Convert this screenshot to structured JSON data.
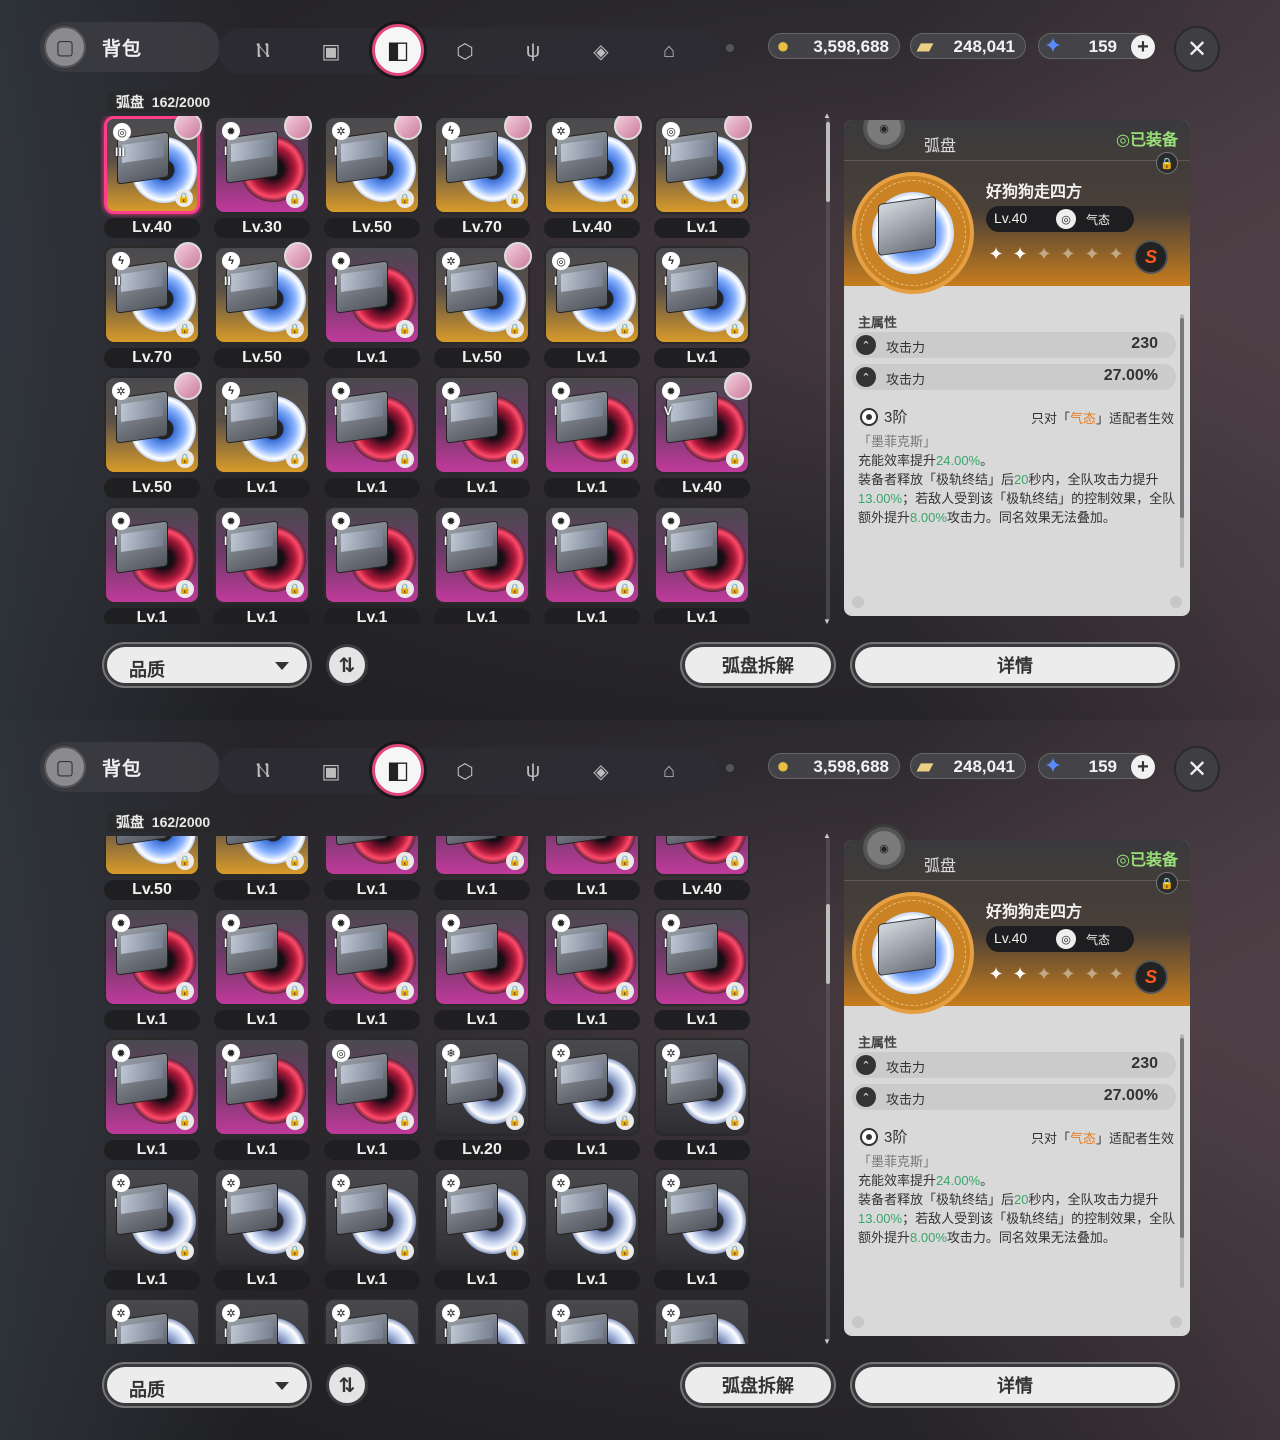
{
  "header": {
    "title": "背包",
    "tabs": [
      {
        "icon": "n-logo-icon"
      },
      {
        "icon": "gameboy-icon"
      },
      {
        "icon": "disc-tab-icon",
        "active": true
      },
      {
        "icon": "cube-icon"
      },
      {
        "icon": "fork-knife-icon"
      },
      {
        "icon": "box-stack-icon"
      },
      {
        "icon": "home-icon"
      }
    ],
    "currencies": [
      {
        "icon": "gold-coin-icon",
        "value": "3,598,688"
      },
      {
        "icon": "ticket-icon",
        "value": "248,041"
      },
      {
        "icon": "crystal-icon",
        "value": "159"
      }
    ],
    "close_label": "✕"
  },
  "grid": {
    "category": "弧盘",
    "count": "162/2000"
  },
  "screen1_rows": [
    [
      {
        "lv": "Lv.40",
        "q": "gold",
        "rank": "III",
        "avatar": true,
        "selected": true,
        "attr": "ether"
      },
      {
        "lv": "Lv.30",
        "q": "purple",
        "rank": "I",
        "avatar": true,
        "attr": "fire"
      },
      {
        "lv": "Lv.50",
        "q": "gold",
        "rank": "I",
        "avatar": true,
        "attr": "phys"
      },
      {
        "lv": "Lv.70",
        "q": "gold",
        "rank": "I",
        "avatar": true,
        "attr": "elec"
      },
      {
        "lv": "Lv.40",
        "q": "gold",
        "rank": "I",
        "avatar": true,
        "attr": "phys"
      },
      {
        "lv": "Lv.1",
        "q": "gold",
        "rank": "II",
        "avatar": true,
        "attr": "ether"
      }
    ],
    [
      {
        "lv": "Lv.70",
        "q": "gold",
        "rank": "II",
        "avatar": true,
        "attr": "elec"
      },
      {
        "lv": "Lv.50",
        "q": "gold",
        "rank": "II",
        "avatar": true,
        "attr": "elec"
      },
      {
        "lv": "Lv.1",
        "q": "purple",
        "rank": "I",
        "avatar": false,
        "attr": "fire"
      },
      {
        "lv": "Lv.50",
        "q": "gold",
        "rank": "I",
        "avatar": true,
        "attr": "phys"
      },
      {
        "lv": "Lv.1",
        "q": "gold",
        "rank": "I",
        "avatar": false,
        "attr": "ether"
      },
      {
        "lv": "Lv.1",
        "q": "gold",
        "rank": "I",
        "avatar": false,
        "attr": "elec"
      }
    ],
    [
      {
        "lv": "Lv.50",
        "q": "gold",
        "rank": "I",
        "avatar": true,
        "attr": "phys"
      },
      {
        "lv": "Lv.1",
        "q": "gold",
        "rank": "I",
        "avatar": false,
        "attr": "elec"
      },
      {
        "lv": "Lv.1",
        "q": "purple",
        "rank": "I",
        "avatar": false,
        "attr": "fire"
      },
      {
        "lv": "Lv.1",
        "q": "purple",
        "rank": "I",
        "avatar": false,
        "attr": "fire"
      },
      {
        "lv": "Lv.1",
        "q": "purple",
        "rank": "I",
        "avatar": false,
        "attr": "fire"
      },
      {
        "lv": "Lv.40",
        "q": "purple",
        "rank": "V",
        "avatar": true,
        "attr": "fire"
      }
    ],
    [
      {
        "lv": "Lv.1",
        "q": "purple",
        "rank": "I",
        "avatar": false,
        "attr": "fire"
      },
      {
        "lv": "Lv.1",
        "q": "purple",
        "rank": "I",
        "avatar": false,
        "attr": "fire"
      },
      {
        "lv": "Lv.1",
        "q": "purple",
        "rank": "I",
        "avatar": false,
        "attr": "fire"
      },
      {
        "lv": "Lv.1",
        "q": "purple",
        "rank": "I",
        "avatar": false,
        "attr": "fire"
      },
      {
        "lv": "Lv.1",
        "q": "purple",
        "rank": "I",
        "avatar": false,
        "attr": "fire"
      },
      {
        "lv": "Lv.1",
        "q": "purple",
        "rank": "I",
        "avatar": false,
        "attr": "fire"
      }
    ]
  ],
  "screen2_rows": [
    [
      {
        "lv": "Lv.50",
        "q": "gold",
        "rank": "I",
        "attr": "phys"
      },
      {
        "lv": "Lv.1",
        "q": "gold",
        "rank": "I",
        "attr": "elec"
      },
      {
        "lv": "Lv.1",
        "q": "purple",
        "rank": "I",
        "attr": "fire"
      },
      {
        "lv": "Lv.1",
        "q": "purple",
        "rank": "I",
        "attr": "fire"
      },
      {
        "lv": "Lv.1",
        "q": "purple",
        "rank": "I",
        "attr": "fire"
      },
      {
        "lv": "Lv.40",
        "q": "purple",
        "rank": "I",
        "attr": "fire"
      }
    ],
    [
      {
        "lv": "Lv.1",
        "q": "purple",
        "rank": "I",
        "attr": "fire"
      },
      {
        "lv": "Lv.1",
        "q": "purple",
        "rank": "I",
        "attr": "fire"
      },
      {
        "lv": "Lv.1",
        "q": "purple",
        "rank": "I",
        "attr": "fire"
      },
      {
        "lv": "Lv.1",
        "q": "purple",
        "rank": "I",
        "attr": "fire"
      },
      {
        "lv": "Lv.1",
        "q": "purple",
        "rank": "I",
        "attr": "fire"
      },
      {
        "lv": "Lv.1",
        "q": "purple",
        "rank": "I",
        "attr": "fire"
      }
    ],
    [
      {
        "lv": "Lv.1",
        "q": "purple",
        "rank": "I",
        "attr": "fire"
      },
      {
        "lv": "Lv.1",
        "q": "purple",
        "rank": "I",
        "attr": "fire"
      },
      {
        "lv": "Lv.1",
        "q": "purple",
        "rank": "I",
        "attr": "ether"
      },
      {
        "lv": "Lv.20",
        "q": "plain",
        "rank": "I",
        "attr": "ice"
      },
      {
        "lv": "Lv.1",
        "q": "plain",
        "rank": "I",
        "attr": "phys"
      },
      {
        "lv": "Lv.1",
        "q": "plain",
        "rank": "I",
        "attr": "phys"
      }
    ],
    [
      {
        "lv": "Lv.1",
        "q": "plain",
        "rank": "I",
        "attr": "phys"
      },
      {
        "lv": "Lv.1",
        "q": "plain",
        "rank": "I",
        "attr": "phys"
      },
      {
        "lv": "Lv.1",
        "q": "plain",
        "rank": "I",
        "attr": "phys"
      },
      {
        "lv": "Lv.1",
        "q": "plain",
        "rank": "I",
        "attr": "phys"
      },
      {
        "lv": "Lv.1",
        "q": "plain",
        "rank": "I",
        "attr": "phys"
      },
      {
        "lv": "Lv.1",
        "q": "plain",
        "rank": "I",
        "attr": "phys"
      }
    ],
    [
      {
        "lv": "",
        "q": "plain",
        "rank": "I",
        "attr": "phys"
      },
      {
        "lv": "",
        "q": "plain",
        "rank": "I",
        "attr": "phys"
      },
      {
        "lv": "",
        "q": "plain",
        "rank": "I",
        "attr": "phys"
      },
      {
        "lv": "",
        "q": "plain",
        "rank": "I",
        "attr": "phys"
      },
      {
        "lv": "",
        "q": "plain",
        "rank": "I",
        "attr": "phys"
      },
      {
        "lv": "",
        "q": "plain",
        "rank": "I",
        "attr": "phys"
      }
    ]
  ],
  "footer": {
    "quality_label": "品质",
    "sort_icon": "sort-arrows-icon",
    "dismantle_label": "弧盘拆解",
    "details_label": "详情"
  },
  "detail": {
    "type_label": "弧盘",
    "equipped_label": "◎已装备",
    "name": "好狗狗走四方",
    "level": "Lv.40",
    "attribute": "气态",
    "stars_filled": 2,
    "stars_total": 7,
    "rank_badge": "S",
    "main_stat_label": "主属性",
    "stats": [
      {
        "name": "攻击力",
        "value": "230"
      },
      {
        "name": "攻击力",
        "value": "27.00%"
      }
    ],
    "tier": "3阶",
    "effect_prefix": "只对「",
    "effect_attr": "气态",
    "effect_suffix": "」适配者生效",
    "set_name": "「墨菲克斯」",
    "desc": {
      "p1a": "充能效率提升",
      "p1b": "24.00%",
      "p1c": "。",
      "p2a": "装备者释放「极轨终结」后",
      "p2b": "20",
      "p2c": "秒内，全队攻击力提升",
      "p2d": "13.00%",
      "p2e": "；若敌人受到该「极轨终结」的控制效果，全队额外提升",
      "p2f": "8.00%",
      "p2g": "攻击力。同名效果无法叠加。"
    }
  },
  "colors": {
    "selected_border": "#ff3d8a",
    "equipped_green": "#9adf7a",
    "highlight_green": "#3aa56a",
    "highlight_orange": "#e87a1e",
    "quality_gold": "#d99b2a",
    "quality_purple": "#c03a9a"
  }
}
